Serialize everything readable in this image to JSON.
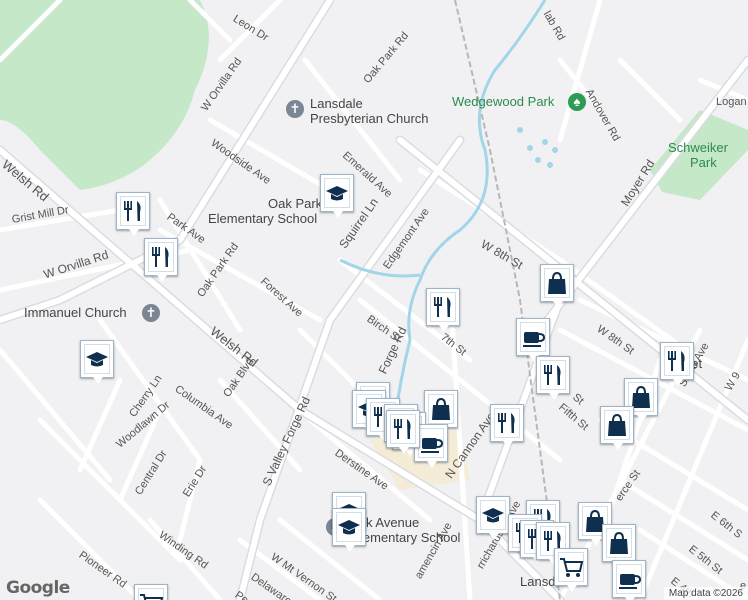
{
  "map": {
    "attribution": "Map data ©2026",
    "logo": "Google",
    "colors": {
      "background": "#f1f1f3",
      "park": "#c5e8c8",
      "water": "#a3d5e8",
      "road": "#ffffff",
      "major_road": "#dadce0",
      "rail": "#b7b7b7",
      "marker_icon": "#0f2f4f"
    }
  },
  "streets": [
    {
      "id": "leon-dr",
      "text": "Leon Dr"
    },
    {
      "id": "w-orvilla-rd",
      "text": "W Orvilla Rd"
    },
    {
      "id": "oak-park-rd-north",
      "text": "Oak Park Rd"
    },
    {
      "id": "woodside-ave",
      "text": "Woodside Ave"
    },
    {
      "id": "emerald-ave",
      "text": "Emerald Ave"
    },
    {
      "id": "welsh-rd-west",
      "text": "Welsh Rd"
    },
    {
      "id": "grist-mill-dr",
      "text": "Grist Mill Dr"
    },
    {
      "id": "park-ave",
      "text": "Park Ave"
    },
    {
      "id": "squirrel-ln",
      "text": "Squirrel Ln"
    },
    {
      "id": "edgemont-ave",
      "text": "Edgemont Ave"
    },
    {
      "id": "w-orvilla-rd-west",
      "text": "W Orvilla Rd"
    },
    {
      "id": "oak-park-rd",
      "text": "Oak Park Rd"
    },
    {
      "id": "forest-ave",
      "text": "Forest Ave"
    },
    {
      "id": "w-8th-st",
      "text": "W 8th St"
    },
    {
      "id": "birch-st",
      "text": "Birch St"
    },
    {
      "id": "seventh-st",
      "text": "7th St"
    },
    {
      "id": "welsh-rd",
      "text": "Welsh Rd"
    },
    {
      "id": "forge-rd",
      "text": "Forge Rd"
    },
    {
      "id": "cherry-ln",
      "text": "Cherry Ln"
    },
    {
      "id": "columbia-ave",
      "text": "Columbia Ave"
    },
    {
      "id": "oak-blvd",
      "text": "Oak Blvd"
    },
    {
      "id": "woodlawn-dr",
      "text": "Woodlawn Dr"
    },
    {
      "id": "central-dr",
      "text": "Central Dr"
    },
    {
      "id": "erie-dr",
      "text": "Erie Dr"
    },
    {
      "id": "s-valley-forge-rd",
      "text": "S Valley Forge Rd"
    },
    {
      "id": "derstine-ave",
      "text": "Derstine Ave"
    },
    {
      "id": "n-cannon-ave",
      "text": "N Cannon Ave"
    },
    {
      "id": "winding-rd",
      "text": "Winding Rd"
    },
    {
      "id": "pioneer-rd",
      "text": "Pioneer Rd"
    },
    {
      "id": "w-mt-vernon-st",
      "text": "W Mt Vernon St"
    },
    {
      "id": "delaware-ave",
      "text": "Delaware Ave"
    },
    {
      "id": "perkio",
      "text": "Perkio"
    },
    {
      "id": "w-8th-st-east",
      "text": "W 8th St"
    },
    {
      "id": "fifth-st",
      "text": "Fifth St"
    },
    {
      "id": "moyer-rd",
      "text": "Moyer Rd"
    },
    {
      "id": "andover-rd",
      "text": "Andover Rd"
    },
    {
      "id": "logan",
      "text": "Logan"
    },
    {
      "id": "shaw-ave",
      "text": "Shaw Ave"
    },
    {
      "id": "e-6th-st",
      "text": "E 6th S"
    },
    {
      "id": "e-5th-st",
      "text": "E 5th St"
    },
    {
      "id": "e-4th",
      "text": "E 4th"
    },
    {
      "id": "rrichardson-ave",
      "text": "rrichardson Ave"
    },
    {
      "id": "amencin-ave",
      "text": "amencin Ave"
    },
    {
      "id": "erce-st",
      "text": "erce St"
    },
    {
      "id": "lab-rd",
      "text": "lab Rd"
    },
    {
      "id": "st-partial",
      "text": "St"
    },
    {
      "id": "w-9-partial",
      "text": "W 9"
    },
    {
      "id": "e-partial",
      "text": "e"
    }
  ],
  "places": [
    {
      "id": "lansdale-presbyterian",
      "line1": "Lansdale",
      "line2": "Presbyterian Church",
      "icon": "cross-icon"
    },
    {
      "id": "wedgewood-park",
      "line1": "Wedgewood Park",
      "line2": "",
      "icon": "tree-icon"
    },
    {
      "id": "schweiker-park",
      "line1": "Schweiker",
      "line2": "Park",
      "icon": ""
    },
    {
      "id": "oak-park-elementary",
      "line1": "Oak Park",
      "line2": "Elementary School",
      "icon": "school-icon"
    },
    {
      "id": "immanuel-church",
      "line1": "Immanuel Church",
      "line2": "",
      "icon": "cross-icon"
    },
    {
      "id": "park-avenue-elementary",
      "line1": "k Avenue",
      "line2": "lementary School",
      "icon": "school-icon"
    },
    {
      "id": "lansdale",
      "line1": "Lansda",
      "line2": "",
      "icon": ""
    },
    {
      "id": "street-partial",
      "line1": "eet",
      "line2": "",
      "icon": ""
    }
  ],
  "markers": [
    {
      "type": "restaurant",
      "icon": "fork-knife-icon"
    },
    {
      "type": "restaurant",
      "icon": "fork-knife-icon"
    },
    {
      "type": "school",
      "icon": "graduation-cap-icon"
    },
    {
      "type": "school",
      "icon": "graduation-cap-icon"
    },
    {
      "type": "shopping",
      "icon": "shopping-bag-icon"
    },
    {
      "type": "restaurant",
      "icon": "fork-knife-icon"
    },
    {
      "type": "cafe",
      "icon": "coffee-cup-icon"
    },
    {
      "type": "restaurant",
      "icon": "fork-knife-icon"
    },
    {
      "type": "restaurant",
      "icon": "fork-knife-icon"
    },
    {
      "type": "shopping",
      "icon": "shopping-bag-icon"
    },
    {
      "type": "shopping",
      "icon": "shopping-bag-icon"
    },
    {
      "type": "restaurant",
      "icon": "fork-knife-icon"
    },
    {
      "type": "restaurant",
      "icon": "fork-knife-icon"
    },
    {
      "type": "school",
      "icon": "graduation-cap-icon"
    },
    {
      "type": "restaurant",
      "icon": "fork-knife-icon"
    },
    {
      "type": "shopping",
      "icon": "shopping-bag-icon"
    },
    {
      "type": "restaurant",
      "icon": "fork-knife-icon"
    },
    {
      "type": "restaurant",
      "icon": "fork-knife-icon"
    },
    {
      "type": "cafe",
      "icon": "coffee-cup-icon"
    },
    {
      "type": "restaurant",
      "icon": "fork-knife-icon"
    },
    {
      "type": "school",
      "icon": "graduation-cap-icon"
    },
    {
      "type": "school",
      "icon": "graduation-cap-icon"
    },
    {
      "type": "school",
      "icon": "graduation-cap-icon"
    },
    {
      "type": "restaurant",
      "icon": "fork-knife-icon"
    },
    {
      "type": "restaurant",
      "icon": "fork-knife-icon"
    },
    {
      "type": "restaurant",
      "icon": "fork-knife-icon"
    },
    {
      "type": "restaurant",
      "icon": "fork-knife-icon"
    },
    {
      "type": "shopping",
      "icon": "shopping-bag-icon"
    },
    {
      "type": "shopping",
      "icon": "shopping-bag-icon"
    },
    {
      "type": "grocery",
      "icon": "shopping-cart-icon"
    },
    {
      "type": "cafe",
      "icon": "coffee-cup-icon"
    },
    {
      "type": "grocery",
      "icon": "shopping-cart-icon"
    }
  ]
}
